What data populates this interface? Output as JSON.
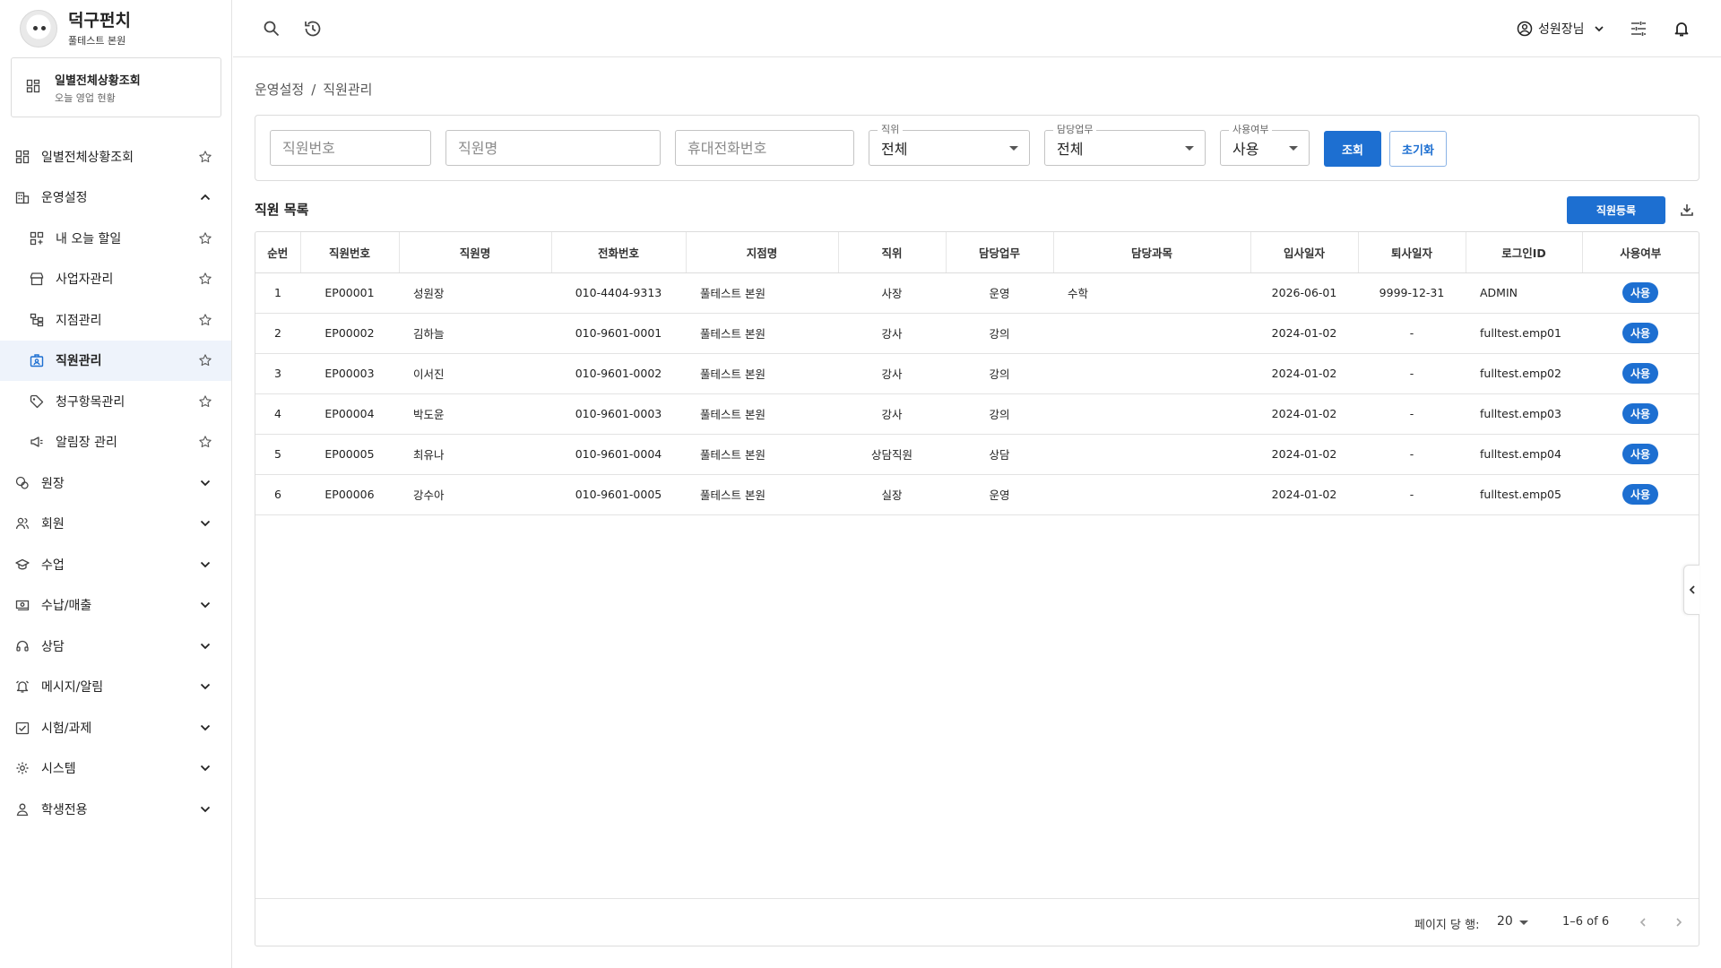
{
  "brand": {
    "title": "덕구펀치",
    "subtitle": "풀테스트 본원"
  },
  "today_card": {
    "title": "일별전체상황조회",
    "subtitle": "오늘 영업 현황"
  },
  "nav": {
    "items": [
      {
        "label": "일별전체상황조회",
        "icon": "dashboard-icon",
        "right": "star-icon"
      },
      {
        "label": "운영설정",
        "icon": "building-icon",
        "right": "chevron-up-icon"
      },
      {
        "label": "내 오늘 할일",
        "icon": "todo-icon",
        "right": "star-icon"
      },
      {
        "label": "사업자관리",
        "icon": "store-icon",
        "right": "star-icon"
      },
      {
        "label": "지점관리",
        "icon": "branch-icon",
        "right": "star-icon"
      },
      {
        "label": "직원관리",
        "icon": "badge-icon",
        "right": "star-icon"
      },
      {
        "label": "청구항목관리",
        "icon": "tag-icon",
        "right": "star-icon"
      },
      {
        "label": "알림장 관리",
        "icon": "megaphone-icon",
        "right": "star-icon"
      },
      {
        "label": "원장",
        "icon": "ledger-icon",
        "right": "chevron-down-icon"
      },
      {
        "label": "회원",
        "icon": "members-icon",
        "right": "chevron-down-icon"
      },
      {
        "label": "수업",
        "icon": "graduation-icon",
        "right": "chevron-down-icon"
      },
      {
        "label": "수납/매출",
        "icon": "payment-icon",
        "right": "chevron-down-icon"
      },
      {
        "label": "상담",
        "icon": "headset-icon",
        "right": "chevron-down-icon"
      },
      {
        "label": "메시지/알림",
        "icon": "alarm-icon",
        "right": "chevron-down-icon"
      },
      {
        "label": "시험/과제",
        "icon": "checkbox-icon",
        "right": "chevron-down-icon"
      },
      {
        "label": "시스템",
        "icon": "gear-icon",
        "right": "chevron-down-icon"
      },
      {
        "label": "학생전용",
        "icon": "person-icon",
        "right": "chevron-down-icon"
      }
    ]
  },
  "topbar": {
    "user_name": "성원장님"
  },
  "breadcrumb": {
    "parent": "운영설정",
    "separator": "/",
    "current": "직원관리"
  },
  "filter": {
    "emp_no_placeholder": "직원번호",
    "emp_name_placeholder": "직원명",
    "phone_placeholder": "휴대전화번호",
    "position_label": "직위",
    "position_value": "전체",
    "duty_label": "담당업무",
    "duty_value": "전체",
    "use_label": "사용여부",
    "use_value": "사용",
    "search_button": "조회",
    "reset_button": "초기화"
  },
  "list": {
    "title": "직원 목록",
    "register_button": "직원등록",
    "columns": [
      "순번",
      "직원번호",
      "직원명",
      "전화번호",
      "지점명",
      "직위",
      "담당업무",
      "담당과목",
      "입사일자",
      "퇴사일자",
      "로그인ID",
      "사용여부"
    ],
    "rows": [
      [
        "1",
        "EP00001",
        "성원장",
        "010-4404-9313",
        "풀테스트 본원",
        "사장",
        "운영",
        "수학",
        "2026-06-01",
        "9999-12-31",
        "ADMIN",
        "사용"
      ],
      [
        "2",
        "EP00002",
        "김하늘",
        "010-9601-0001",
        "풀테스트 본원",
        "강사",
        "강의",
        "",
        "2024-01-02",
        "-",
        "fulltest.emp01",
        "사용"
      ],
      [
        "3",
        "EP00003",
        "이서진",
        "010-9601-0002",
        "풀테스트 본원",
        "강사",
        "강의",
        "",
        "2024-01-02",
        "-",
        "fulltest.emp02",
        "사용"
      ],
      [
        "4",
        "EP00004",
        "박도윤",
        "010-9601-0003",
        "풀테스트 본원",
        "강사",
        "강의",
        "",
        "2024-01-02",
        "-",
        "fulltest.emp03",
        "사용"
      ],
      [
        "5",
        "EP00005",
        "최유나",
        "010-9601-0004",
        "풀테스트 본원",
        "상담직원",
        "상담",
        "",
        "2024-01-02",
        "-",
        "fulltest.emp04",
        "사용"
      ],
      [
        "6",
        "EP00006",
        "강수아",
        "010-9601-0005",
        "풀테스트 본원",
        "실장",
        "운영",
        "",
        "2024-01-02",
        "-",
        "fulltest.emp05",
        "사용"
      ]
    ]
  },
  "pager": {
    "rows_label": "페이지 당 행:",
    "rows_value": "20",
    "range": "1–6 of 6"
  },
  "colors": {
    "primary": "#1d6fd1",
    "active_bg": "#eef3fb",
    "border": "#dcdcdc"
  }
}
